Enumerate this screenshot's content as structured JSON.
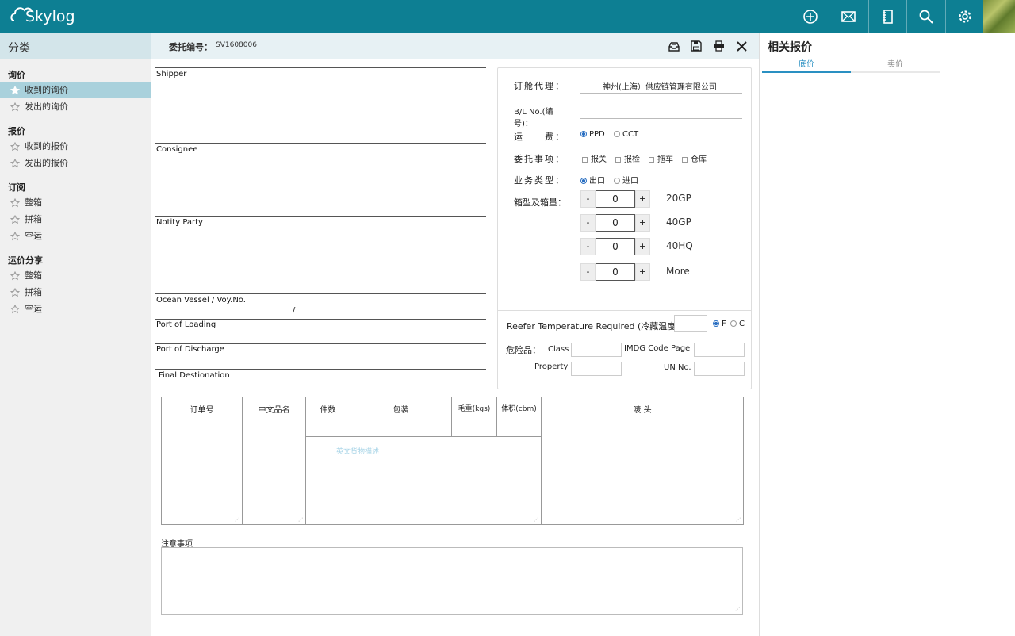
{
  "app": {
    "logo_text": "Skylog"
  },
  "topbar": {
    "icons": [
      "plus-circle-icon",
      "mail-icon",
      "notebook-icon",
      "search-icon",
      "gear-icon"
    ]
  },
  "sidebar": {
    "title": "分类",
    "sections": [
      {
        "title": "询价",
        "items": [
          {
            "label": "收到的询价",
            "active": true
          },
          {
            "label": "发出的询价"
          }
        ]
      },
      {
        "title": "报价",
        "items": [
          {
            "label": "收到的报价"
          },
          {
            "label": "发出的报价"
          }
        ]
      },
      {
        "title": "订阅",
        "items": [
          {
            "label": "整箱"
          },
          {
            "label": "拼箱"
          },
          {
            "label": "空运"
          }
        ]
      },
      {
        "title": "运价分享",
        "items": [
          {
            "label": "整箱"
          },
          {
            "label": "拼箱"
          },
          {
            "label": "空运"
          }
        ]
      }
    ]
  },
  "header": {
    "order_label": "委托编号：",
    "order_no": "SV1608006"
  },
  "form": {
    "shipper": "Shipper",
    "consignee": "Consignee",
    "notify": "Notity Party",
    "vessel": "Ocean Vessel / Voy.No.",
    "vessel_sep": "/",
    "pol": "Port of Loading",
    "pod": "Port of Discharge",
    "final_dest": "Final Destionation"
  },
  "booking": {
    "agent_label": "订舱代理：",
    "agent_value": "神州(上海）供应链管理有限公司",
    "bl_label": "B/L No.(编号)：",
    "freight_label": "运　　费：",
    "freight_options": [
      "PPD",
      "CCT"
    ],
    "entrust_label": "委托事项：",
    "entrust_options": [
      "报关",
      "报检",
      "拖车",
      "仓库"
    ],
    "biz_label": "业务类型：",
    "biz_options": [
      "出口",
      "进口"
    ],
    "container_label": "箱型及箱量：",
    "minus": "-",
    "plus": "+",
    "containers": [
      {
        "type": "20GP",
        "qty": "0"
      },
      {
        "type": "40GP",
        "qty": "0"
      },
      {
        "type": "40HQ",
        "qty": "0"
      },
      {
        "type": "More",
        "qty": "0"
      }
    ],
    "reefer_label": "Reefer Temperature Required (冷藏温度)",
    "reefer_units": [
      "F",
      "C"
    ],
    "dg_label": "危险品：",
    "class_label": "Class",
    "imdg_label": "IMDG Code Page",
    "property_label": "Property",
    "un_label": "UN No."
  },
  "cargo_table": {
    "headers": [
      "订单号",
      "中文品名",
      "件数",
      "包装",
      "毛重(kgs)",
      "体积(cbm)",
      "唛 头"
    ],
    "desc_placeholder": "英文货物描述"
  },
  "notes": {
    "label": "注意事项"
  },
  "related": {
    "title": "相关报价",
    "tabs": [
      "底价",
      "卖价"
    ]
  }
}
